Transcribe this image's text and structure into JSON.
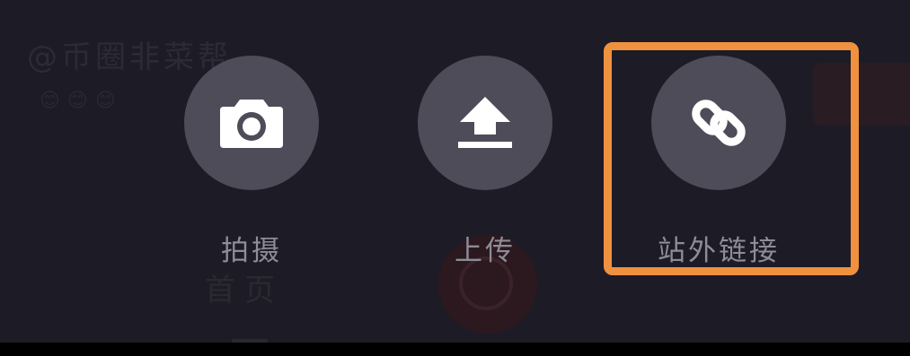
{
  "background": {
    "handle": "@币圈非菜帮",
    "emoji_row": "😊😊😊",
    "home_tab": "首页"
  },
  "actions": [
    {
      "label": "拍摄",
      "icon": "camera-icon"
    },
    {
      "label": "上传",
      "icon": "upload-icon"
    },
    {
      "label": "站外链接",
      "icon": "link-icon"
    }
  ],
  "highlight_color": "#f0913f"
}
